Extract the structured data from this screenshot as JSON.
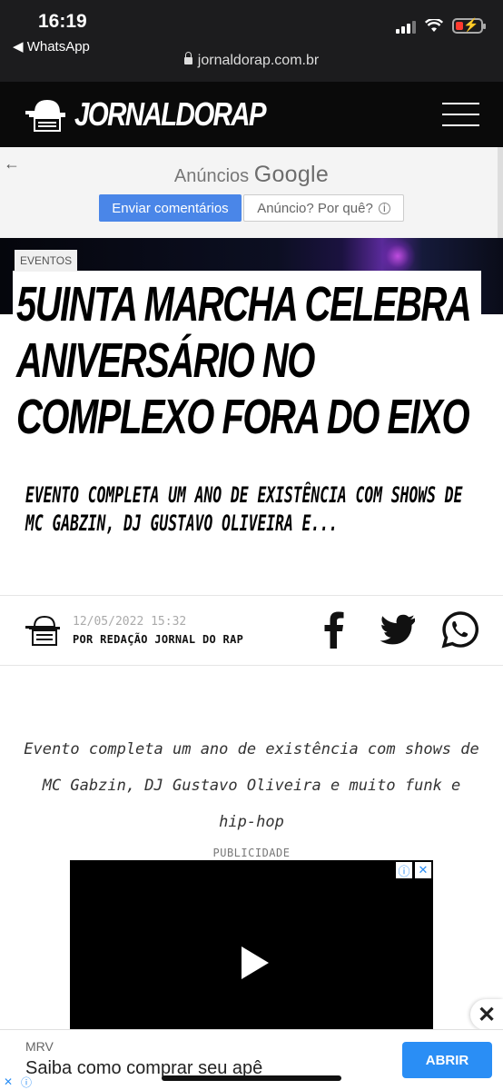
{
  "status_bar": {
    "time": "16:19",
    "back_app": "◀ WhatsApp",
    "url": "jornaldorap.com.br",
    "battery_color": "#ff3b30"
  },
  "site": {
    "logo_text": "JORNALDORAP",
    "menu_icon": "hamburger-menu-icon"
  },
  "ad_notice": {
    "title_prefix": "Anúncios ",
    "title_brand": "Google",
    "send_feedback": "Enviar comentários",
    "why_ad": "Anúncio? Por quê?",
    "info_glyph": "i",
    "back_glyph": "←"
  },
  "article": {
    "tag": "EVENTOS",
    "headline": "5UINTA MARCHA CELEBRA ANIVERSÁRIO NO COMPLEXO FORA DO EIXO",
    "subheadline": "EVENTO COMPLETA UM ANO DE EXISTÊNCIA COM SHOWS DE MC GABZIN, DJ GUSTAVO OLIVEIRA E...",
    "date": "12/05/2022 15:32",
    "author": "POR REDAÇÃO JORNAL DO RAP",
    "share": [
      "facebook-icon",
      "twitter-icon",
      "whatsapp-icon"
    ],
    "excerpt": "Evento completa um ano de existência com shows de MC Gabzin, DJ Gustavo Oliveira e muito funk e hip-hop"
  },
  "publicidade": {
    "label": "PUBLICIDADE",
    "video_ad_info": "ⓘ",
    "video_ad_close": "✕"
  },
  "banner_ad": {
    "close": "✕",
    "brand": "MRV",
    "text": "Saiba como comprar seu apê",
    "cta": "ABRIR",
    "adchoices": [
      "✕",
      "ⓘ"
    ],
    "cta_color": "#2a8ef5"
  }
}
